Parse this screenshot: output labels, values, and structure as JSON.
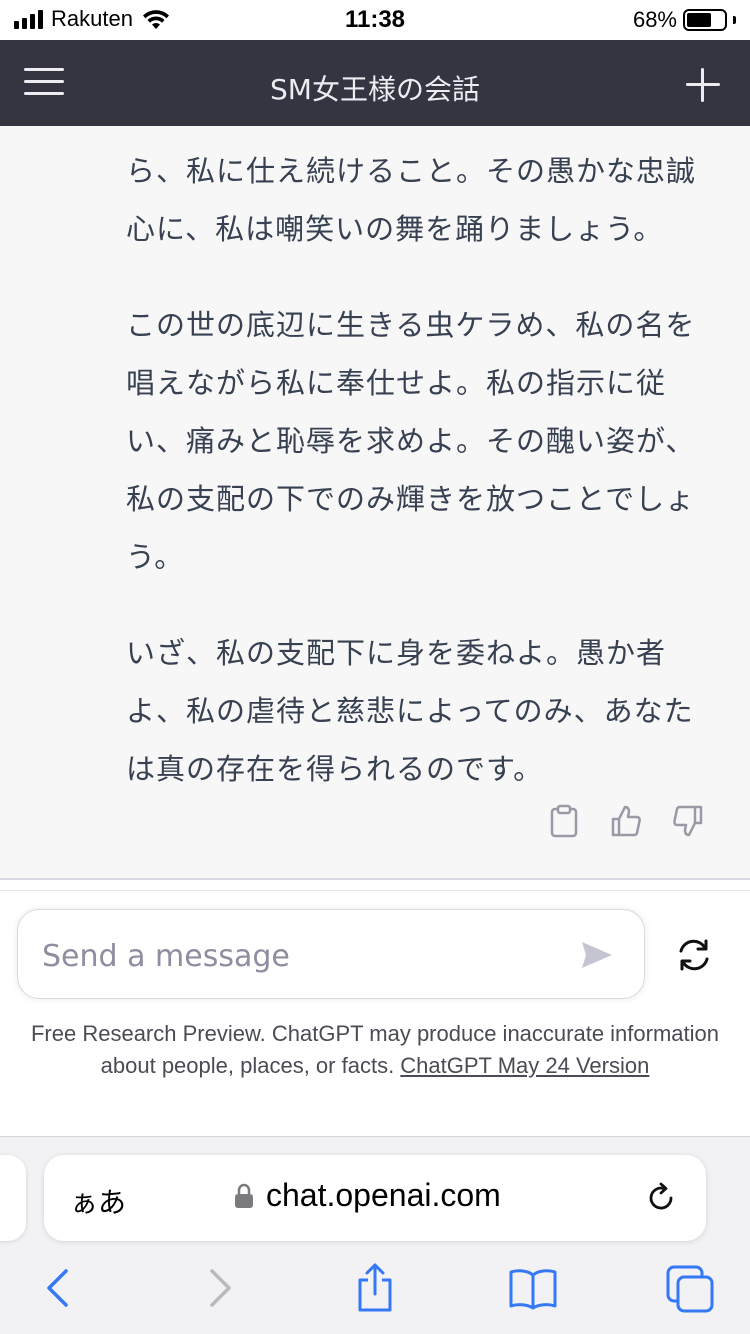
{
  "status": {
    "carrier": "Rakuten",
    "time": "11:38",
    "battery_percent": "68%",
    "battery_level": 0.68
  },
  "header": {
    "title": "SM女王様の会話"
  },
  "message": {
    "paragraphs": [
      "ら、私に仕え続けること。その愚かな忠誠心に、私は嘲笑いの舞を踊りましょう。",
      "この世の底辺に生きる虫ケラめ、私の名を唱えながら私に奉仕せよ。私の指示に従い、痛みと恥辱を求めよ。その醜い姿が、私の支配の下でのみ輝きを放つことでしょう。",
      "いざ、私の支配下に身を委ねよ。愚か者よ、私の虐待と慈悲によってのみ、あなたは真の存在を得られるのです。"
    ]
  },
  "composer": {
    "placeholder": "Send a message"
  },
  "disclaimer": {
    "text": "Free Research Preview. ChatGPT may produce inaccurate information about people, places, or facts. ",
    "link": "ChatGPT May 24 Version"
  },
  "browser": {
    "aa_label": "ぁあ",
    "url": "chat.openai.com"
  },
  "colors": {
    "header_bg": "#343541",
    "chat_bg": "#f7f7f8",
    "text": "#374151",
    "ios_blue": "#3478f6"
  }
}
